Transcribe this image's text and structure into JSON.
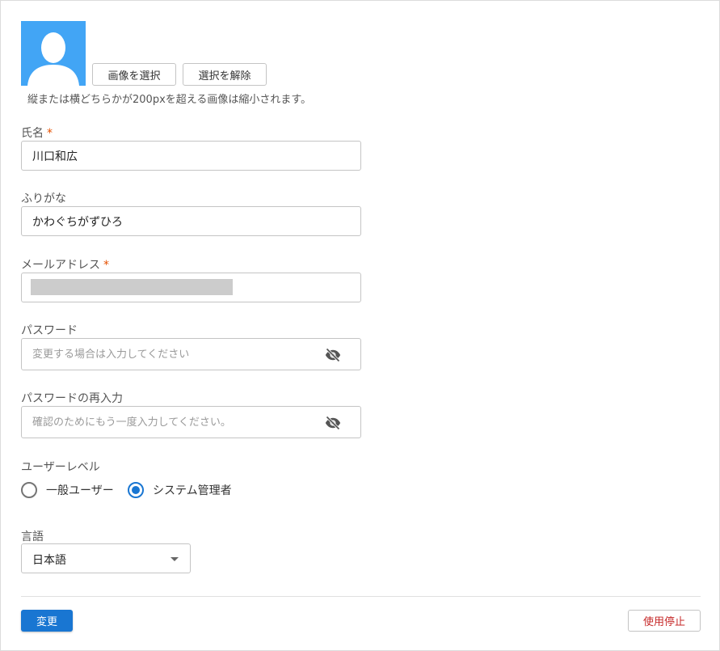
{
  "avatar": {
    "icon": "person-silhouette-icon",
    "background": "#42a5f5"
  },
  "image": {
    "select_label": "画像を選択",
    "clear_label": "選択を解除",
    "hint": "縦または横どちらかが200pxを超える画像は縮小されます。"
  },
  "fields": {
    "name": {
      "label": "氏名",
      "required_mark": "*",
      "value": "川口和広"
    },
    "kana": {
      "label": "ふりがな",
      "value": "かわぐちがずひろ"
    },
    "email": {
      "label": "メールアドレス",
      "required_mark": "*",
      "value": ""
    },
    "password": {
      "label": "パスワード",
      "placeholder": "変更する場合は入力してください",
      "icon": "eye-off-icon"
    },
    "password_confirm": {
      "label": "パスワードの再入力",
      "placeholder": "確認のためにもう一度入力してください。",
      "icon": "eye-off-icon"
    }
  },
  "user_level": {
    "label": "ユーザーレベル",
    "options": [
      {
        "label": "一般ユーザー",
        "checked": false
      },
      {
        "label": "システム管理者",
        "checked": true
      }
    ]
  },
  "language": {
    "label": "言語",
    "selected": "日本語"
  },
  "actions": {
    "submit_label": "変更",
    "suspend_label": "使用停止"
  },
  "colors": {
    "primary": "#1976d2",
    "danger": "#c62828",
    "required": "#e65100"
  }
}
